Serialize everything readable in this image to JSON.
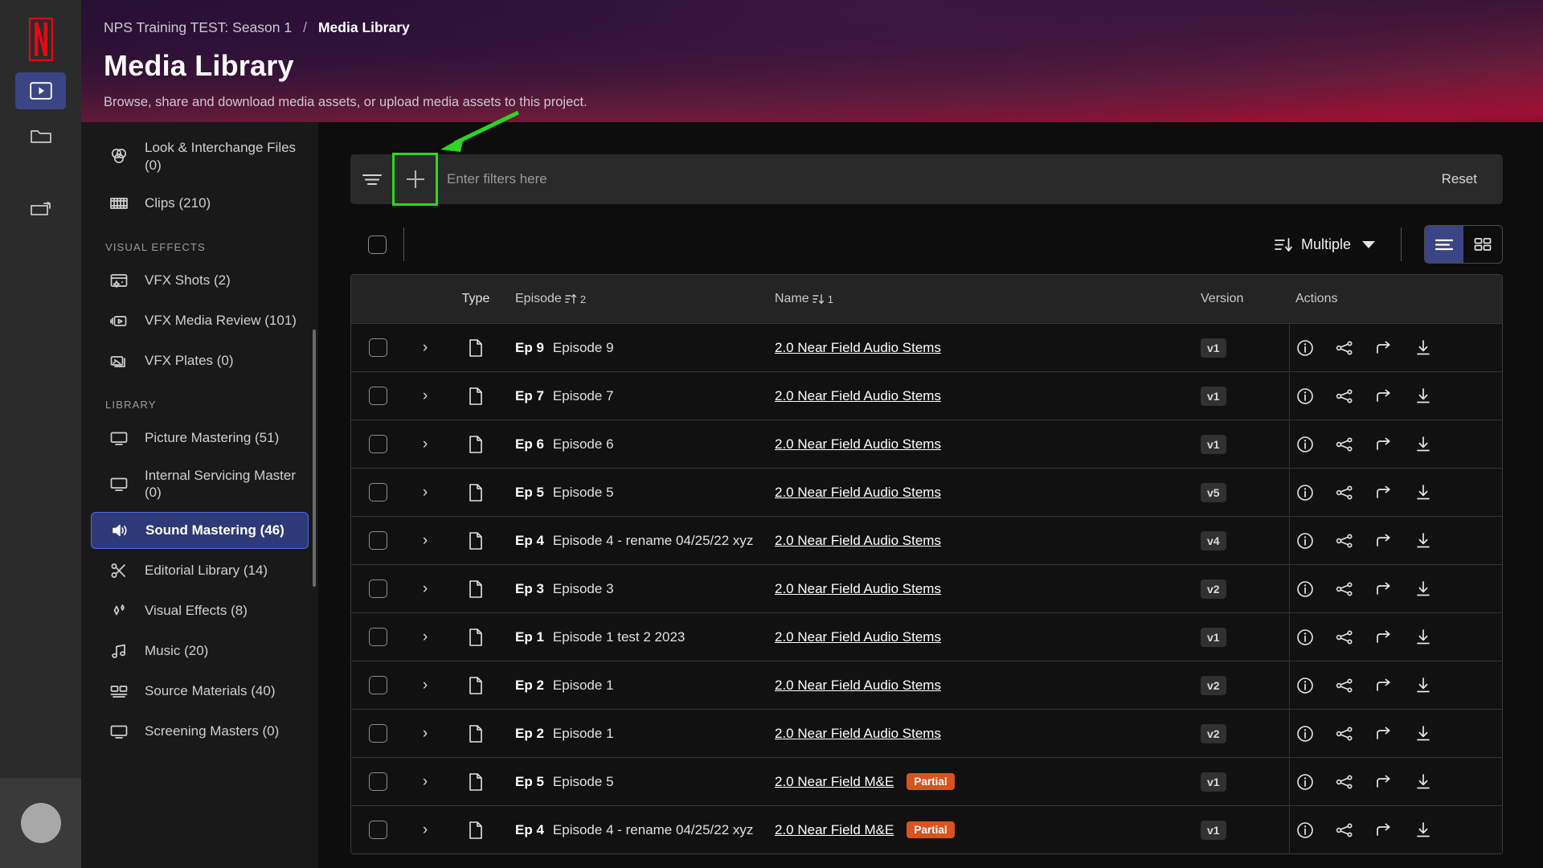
{
  "rail": {
    "brand": "netflix-logo",
    "buttons": [
      {
        "name": "media-player-icon",
        "active": true
      },
      {
        "name": "folder-icon",
        "active": false
      },
      {
        "name": "transfer-icon",
        "active": false
      }
    ],
    "avatar": "user-avatar"
  },
  "header": {
    "breadcrumb_project": "NPS Training TEST: Season 1",
    "breadcrumb_separator": "/",
    "breadcrumb_current": "Media Library",
    "title": "Media Library",
    "subtitle": "Browse, share and download media assets, or upload media assets to this project."
  },
  "sidebar": {
    "items": [
      {
        "label": "Look & Interchange Files (0)",
        "icon": "color-wheel-icon",
        "selected": false,
        "type": "item"
      },
      {
        "label": "Clips (210)",
        "icon": "film-strip-icon",
        "selected": false,
        "type": "item"
      },
      {
        "label": "VISUAL EFFECTS",
        "type": "section"
      },
      {
        "label": "VFX Shots (2)",
        "icon": "vfx-shot-icon",
        "selected": false,
        "type": "item"
      },
      {
        "label": "VFX Media Review (101)",
        "icon": "media-review-icon",
        "selected": false,
        "type": "item"
      },
      {
        "label": "VFX Plates (0)",
        "icon": "plates-icon",
        "selected": false,
        "type": "item"
      },
      {
        "label": "LIBRARY",
        "type": "section"
      },
      {
        "label": "Picture Mastering (51)",
        "icon": "monitor-icon",
        "selected": false,
        "type": "item"
      },
      {
        "label": "Internal Servicing Master (0)",
        "icon": "monitor-icon",
        "selected": false,
        "type": "item"
      },
      {
        "label": "Sound Mastering (46)",
        "icon": "speaker-icon",
        "selected": true,
        "type": "item"
      },
      {
        "label": "Editorial Library (14)",
        "icon": "scissors-icon",
        "selected": false,
        "type": "item"
      },
      {
        "label": "Visual Effects (8)",
        "icon": "sparkle-icon",
        "selected": false,
        "type": "item"
      },
      {
        "label": "Music (20)",
        "icon": "music-note-icon",
        "selected": false,
        "type": "item"
      },
      {
        "label": "Source Materials (40)",
        "icon": "source-materials-icon",
        "selected": false,
        "type": "item"
      },
      {
        "label": "Screening Masters (0)",
        "icon": "monitor-icon",
        "selected": false,
        "type": "item"
      }
    ]
  },
  "filter_bar": {
    "funnel_icon": "filter-icon",
    "add_icon": "plus-icon",
    "value": "",
    "placeholder": "Enter filters here",
    "reset_label": "Reset",
    "highlight_color": "#2bd71f"
  },
  "toolbar": {
    "select_all_checked": false,
    "sort_icon": "sort-descending-icon",
    "sort_label": "Multiple",
    "caret_icon": "chevron-down-icon",
    "view_list_icon": "list-view-icon",
    "view_grid_icon": "grid-view-icon",
    "view_active": "list",
    "active_color": "#3b4585"
  },
  "table": {
    "columns": [
      {
        "key": "type",
        "label": "Type"
      },
      {
        "key": "episode",
        "label": "Episode",
        "sort_dir": "asc",
        "sort_order": "2"
      },
      {
        "key": "name",
        "label": "Name",
        "sort_dir": "desc",
        "sort_order": "1"
      },
      {
        "key": "version",
        "label": "Version"
      },
      {
        "key": "actions",
        "label": "Actions"
      }
    ],
    "action_icons": [
      "info-icon",
      "share-icon",
      "forward-icon",
      "download-icon"
    ],
    "expand_icon": "chevron-right-icon",
    "type_icon": "document-icon",
    "rows": [
      {
        "ep_num": "Ep 9",
        "ep_title": "Episode 9",
        "name": "2.0 Near Field Audio Stems",
        "badge": "",
        "version": "v1"
      },
      {
        "ep_num": "Ep 7",
        "ep_title": "Episode 7",
        "name": "2.0 Near Field Audio Stems",
        "badge": "",
        "version": "v1"
      },
      {
        "ep_num": "Ep 6",
        "ep_title": "Episode 6",
        "name": "2.0 Near Field Audio Stems",
        "badge": "",
        "version": "v1"
      },
      {
        "ep_num": "Ep 5",
        "ep_title": "Episode 5",
        "name": "2.0 Near Field Audio Stems",
        "badge": "",
        "version": "v5"
      },
      {
        "ep_num": "Ep 4",
        "ep_title": "Episode 4 - rename 04/25/22 xyz",
        "name": "2.0 Near Field Audio Stems",
        "badge": "",
        "version": "v4"
      },
      {
        "ep_num": "Ep 3",
        "ep_title": "Episode 3",
        "name": "2.0 Near Field Audio Stems",
        "badge": "",
        "version": "v2"
      },
      {
        "ep_num": "Ep 1",
        "ep_title": "Episode 1 test 2 2023",
        "name": "2.0 Near Field Audio Stems",
        "badge": "",
        "version": "v1"
      },
      {
        "ep_num": "Ep 2",
        "ep_title": "Episode 1",
        "name": "2.0 Near Field Audio Stems",
        "badge": "",
        "version": "v2"
      },
      {
        "ep_num": "Ep 2",
        "ep_title": "Episode 1",
        "name": "2.0 Near Field Audio Stems",
        "badge": "",
        "version": "v2"
      },
      {
        "ep_num": "Ep 5",
        "ep_title": "Episode 5",
        "name": "2.0 Near Field M&E",
        "badge": "Partial",
        "version": "v1"
      },
      {
        "ep_num": "Ep 4",
        "ep_title": "Episode 4 - rename 04/25/22 xyz",
        "name": "2.0 Near Field M&E",
        "badge": "Partial",
        "version": "v1"
      }
    ]
  }
}
